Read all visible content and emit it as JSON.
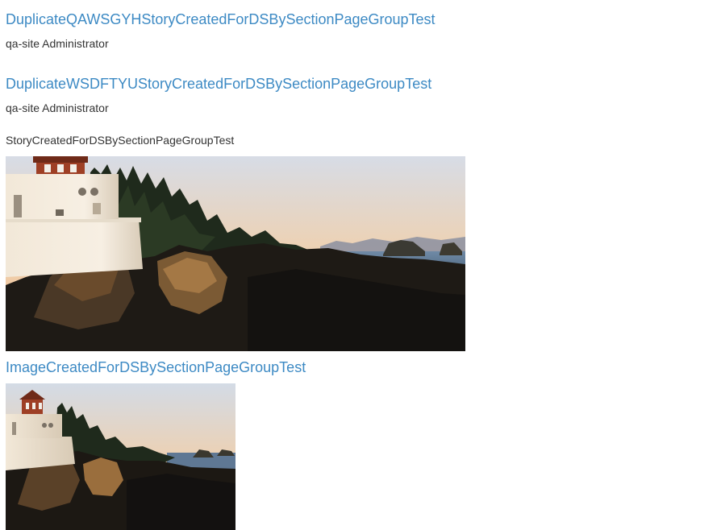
{
  "stories": [
    {
      "title": "DuplicateQAWSGYHStoryCreatedForDSBySectionPageGroupTest",
      "author": "qa-site Administrator"
    },
    {
      "title": "DuplicateWSDFTYUStoryCreatedForDSBySectionPageGroupTest",
      "author": "qa-site Administrator"
    }
  ],
  "story_with_image": {
    "title": "StoryCreatedForDSBySectionPageGroupTest"
  },
  "image_item": {
    "title": "ImageCreatedForDSBySectionPageGroupTest"
  },
  "colors": {
    "link": "#3d8ac4",
    "text": "#333333"
  }
}
